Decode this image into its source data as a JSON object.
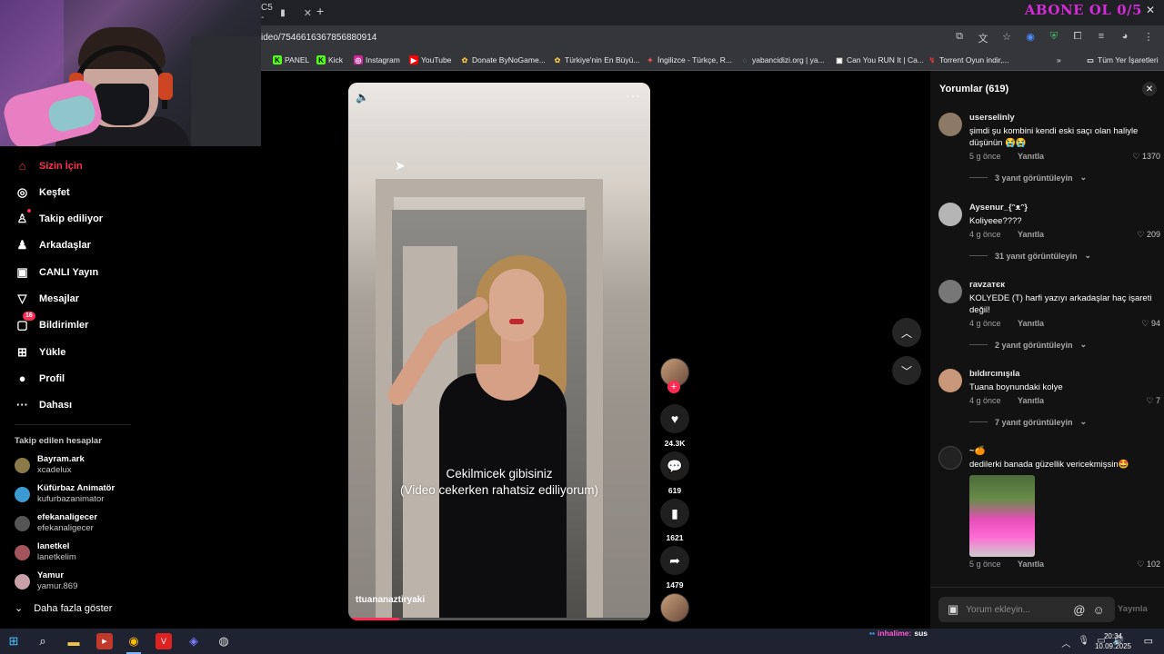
{
  "browser": {
    "tab_title": "C5 - ",
    "url": "ideo/7546616367856880914",
    "overlay_text": "ABONE OL 0/5",
    "bookmarks": [
      {
        "label": "PANEL",
        "icon": "kick-icon"
      },
      {
        "label": "Kick",
        "icon": "kick-icon"
      },
      {
        "label": "Instagram",
        "icon": "instagram-icon"
      },
      {
        "label": "YouTube",
        "icon": "youtube-icon"
      },
      {
        "label": "Donate ByNoGame...",
        "icon": "bynogame-icon"
      },
      {
        "label": "Türkiye'nin En Büyü...",
        "icon": "bynogame-icon"
      },
      {
        "label": "İngilizce - Türkçe, R...",
        "icon": "reverso-icon"
      },
      {
        "label": "yabancidizi.org | ya...",
        "icon": "globe-icon"
      },
      {
        "label": "Can You RUN It | Ca...",
        "icon": "canyourun-icon"
      },
      {
        "label": "Torrent Oyun indir,...",
        "icon": "torrent-icon"
      }
    ],
    "all_bookmarks": "Tüm Yer İşaretleri"
  },
  "sidebar": {
    "nav": [
      {
        "label": "Sizin İçin",
        "icon": "home-icon"
      },
      {
        "label": "Keşfet",
        "icon": "compass-icon"
      },
      {
        "label": "Takip ediliyor",
        "icon": "user-follow-icon"
      },
      {
        "label": "Arkadaşlar",
        "icon": "friends-icon"
      },
      {
        "label": "CANLI Yayın",
        "icon": "live-icon"
      },
      {
        "label": "Mesajlar",
        "icon": "send-icon"
      },
      {
        "label": "Bildirimler",
        "icon": "inbox-icon"
      },
      {
        "label": "Yükle",
        "icon": "upload-icon"
      },
      {
        "label": "Profil",
        "icon": "profile-icon"
      },
      {
        "label": "Dahası",
        "icon": "more-icon"
      }
    ],
    "notification_badge": "16",
    "following_title": "Takip edilen hesaplar",
    "accounts": [
      {
        "name": "Bayram.ark",
        "user": "xcadelux",
        "color": "#8a7a4a"
      },
      {
        "name": "Küfürbaz Animatör",
        "user": "kufurbazanimator",
        "color": "#3b9ad1"
      },
      {
        "name": "efekanaligecer",
        "user": "efekanaligecer",
        "color": "#555"
      },
      {
        "name": "lanetkel",
        "user": "lanetkelim",
        "color": "#a4545c"
      },
      {
        "name": "Yamur",
        "user": "yamur.869",
        "color": "#c9a0a8"
      }
    ],
    "more_label": "Daha fazla göster"
  },
  "video": {
    "caption_line1": "Cekilmicek gibisiniz",
    "caption_line2": "(Video cekerken rahatsiz ediliyorum)",
    "author": "ttuananaztiryaki",
    "progress": 0.17,
    "likes": "24.3K",
    "comments": "619",
    "saves": "1621",
    "shares": "1479"
  },
  "comments_panel": {
    "title": "Yorumlar (619)",
    "items": [
      {
        "user": "userselinly",
        "text": "şimdi şu kombini kendi eski saçı olan haliyle düşünün 😭😭",
        "time": "5 g önce",
        "reply": "Yanıtla",
        "likes": "1370",
        "replies": "3 yanıt görüntüleyin",
        "color": "#8c7a66"
      },
      {
        "user": "Aysenur_{ᵔᴥᵔ}",
        "text": "Koliyeee????",
        "time": "4 g önce",
        "reply": "Yanıtla",
        "likes": "209",
        "replies": "31 yanıt görüntüleyin",
        "color": "#b5b5b5"
      },
      {
        "user": "ravzaтєк",
        "text": "KOLYEDE (T) harfi yazıyı arkadaşlar haç işareti değil!",
        "time": "4 g önce",
        "reply": "Yanıtla",
        "likes": "94",
        "replies": "2 yanıt görüntüleyin",
        "color": "#777"
      },
      {
        "user": "bıldırcınışıla",
        "text": "Tuana boynundaki kolye",
        "time": "4 g önce",
        "reply": "Yanıtla",
        "likes": "7",
        "replies": "7 yanıt görüntüleyin",
        "color": "#c9977a"
      },
      {
        "user": "~🍊",
        "text": "dedilerki banada güzellik vericekmişsin🤩",
        "time": "5 g önce",
        "reply": "Yanıtla",
        "likes": "102",
        "replies": "",
        "color": "#222"
      }
    ],
    "input_placeholder": "Yorum ekleyin...",
    "post_label": "Yayınla"
  },
  "taskbar": {
    "chat_name": "inhalime:",
    "chat_text": "sus",
    "time": "20:34",
    "date": "10.09.2025"
  }
}
